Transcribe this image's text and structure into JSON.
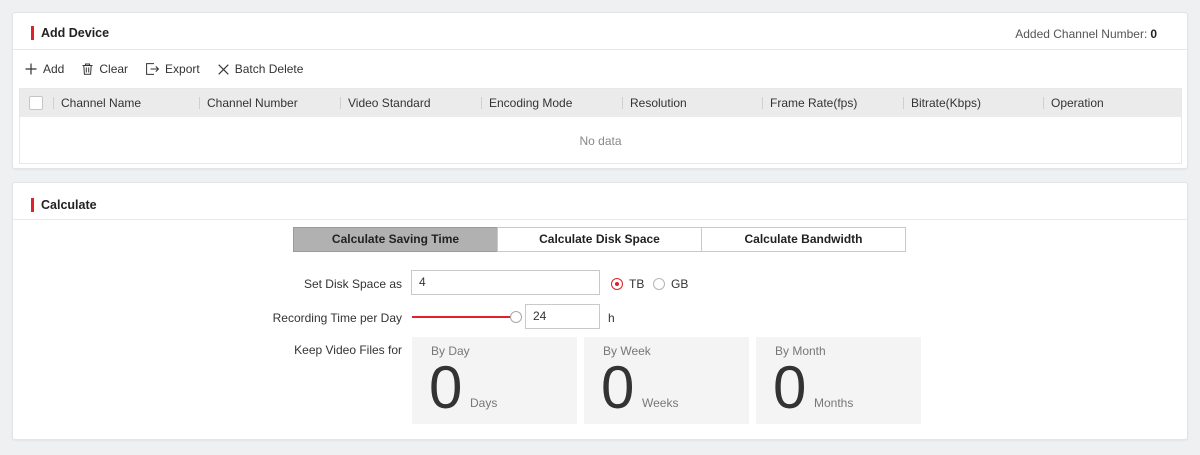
{
  "device_panel": {
    "title": "Add Device",
    "added_label": "Added Channel Number:",
    "added_value": "0",
    "toolbar": {
      "add": "Add",
      "clear": "Clear",
      "export": "Export",
      "batch_delete": "Batch Delete"
    },
    "columns": [
      "Channel Name",
      "Channel Number",
      "Video Standard",
      "Encoding Mode",
      "Resolution",
      "Frame Rate(fps)",
      "Bitrate(Kbps)",
      "Operation"
    ],
    "empty_text": "No data"
  },
  "calc_panel": {
    "title": "Calculate",
    "tabs": [
      "Calculate Saving Time",
      "Calculate Disk Space",
      "Calculate Bandwidth"
    ],
    "active_tab": 0,
    "disk_space": {
      "label": "Set Disk Space as",
      "value": "4",
      "units": [
        "TB",
        "GB"
      ],
      "selected_unit": "TB"
    },
    "recording_time": {
      "label": "Recording Time per Day",
      "value": "24",
      "unit": "h",
      "slider_fraction": 1.0
    },
    "keep": {
      "label": "Keep Video Files for",
      "boxes": [
        {
          "label": "By Day",
          "value": "0",
          "unit": "Days"
        },
        {
          "label": "By Week",
          "value": "0",
          "unit": "Weeks"
        },
        {
          "label": "By Month",
          "value": "0",
          "unit": "Months"
        }
      ]
    }
  },
  "colors": {
    "accent": "#e0202b",
    "active_tab": "#b1b1b1",
    "page_bg": "#eef0f2"
  }
}
